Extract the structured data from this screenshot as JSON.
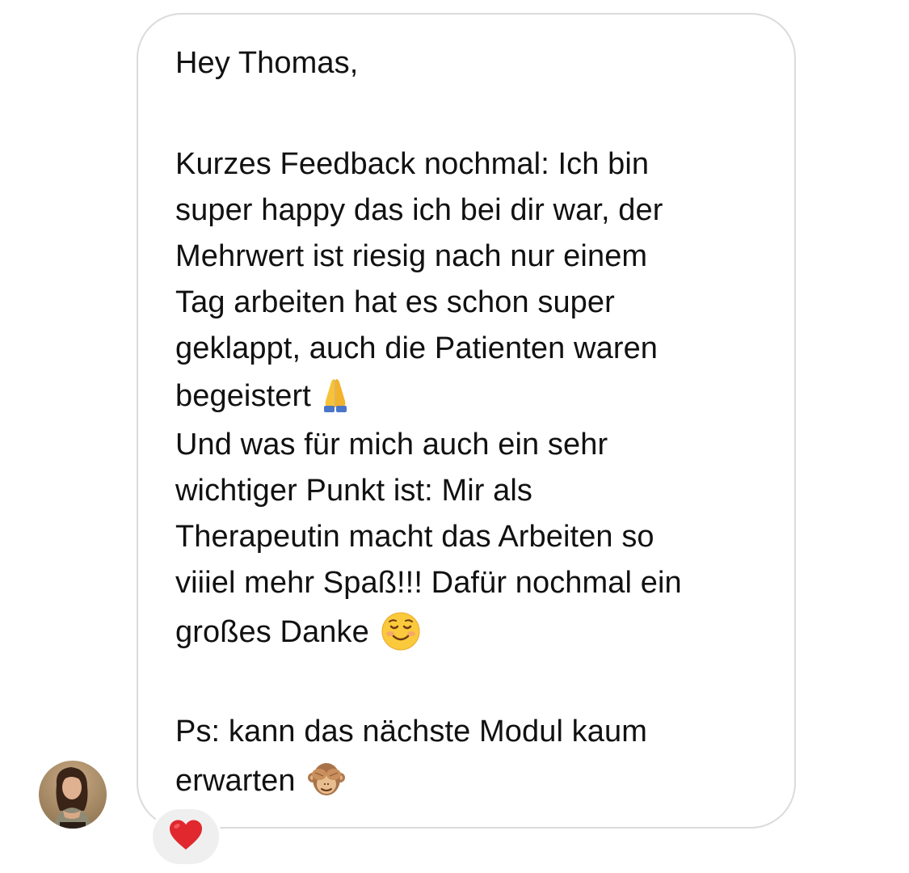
{
  "message": {
    "greeting": "Hey Thomas,",
    "paragraph1_lines": [
      "Kurzes Feedback nochmal: Ich bin",
      "super happy das ich bei dir war, der",
      "Mehrwert ist riesig nach nur einem",
      "Tag arbeiten hat es schon super",
      "geklappt, auch die Patienten waren",
      "begeistert"
    ],
    "paragraph2_lines": [
      "Und was für mich auch ein sehr",
      "wichtiger Punkt ist: Mir als",
      "Therapeutin macht das Arbeiten so",
      "viiiel mehr Spaß!!! Dafür nochmal ein",
      "großes Danke"
    ],
    "ps_lines": [
      "Ps: kann das nächste Modul kaum",
      "erwarten"
    ],
    "emojis": {
      "after_paragraph1": "folded-hands-emoji",
      "after_paragraph2": "smiling-face-emoji",
      "after_ps": "see-no-evil-monkey-emoji"
    }
  },
  "reaction": {
    "icon": "red-heart-emoji",
    "color": "#e0282e"
  },
  "colors": {
    "bubble_border": "#dbdbdb",
    "text": "#111111",
    "reaction_bg": "#efefef"
  }
}
